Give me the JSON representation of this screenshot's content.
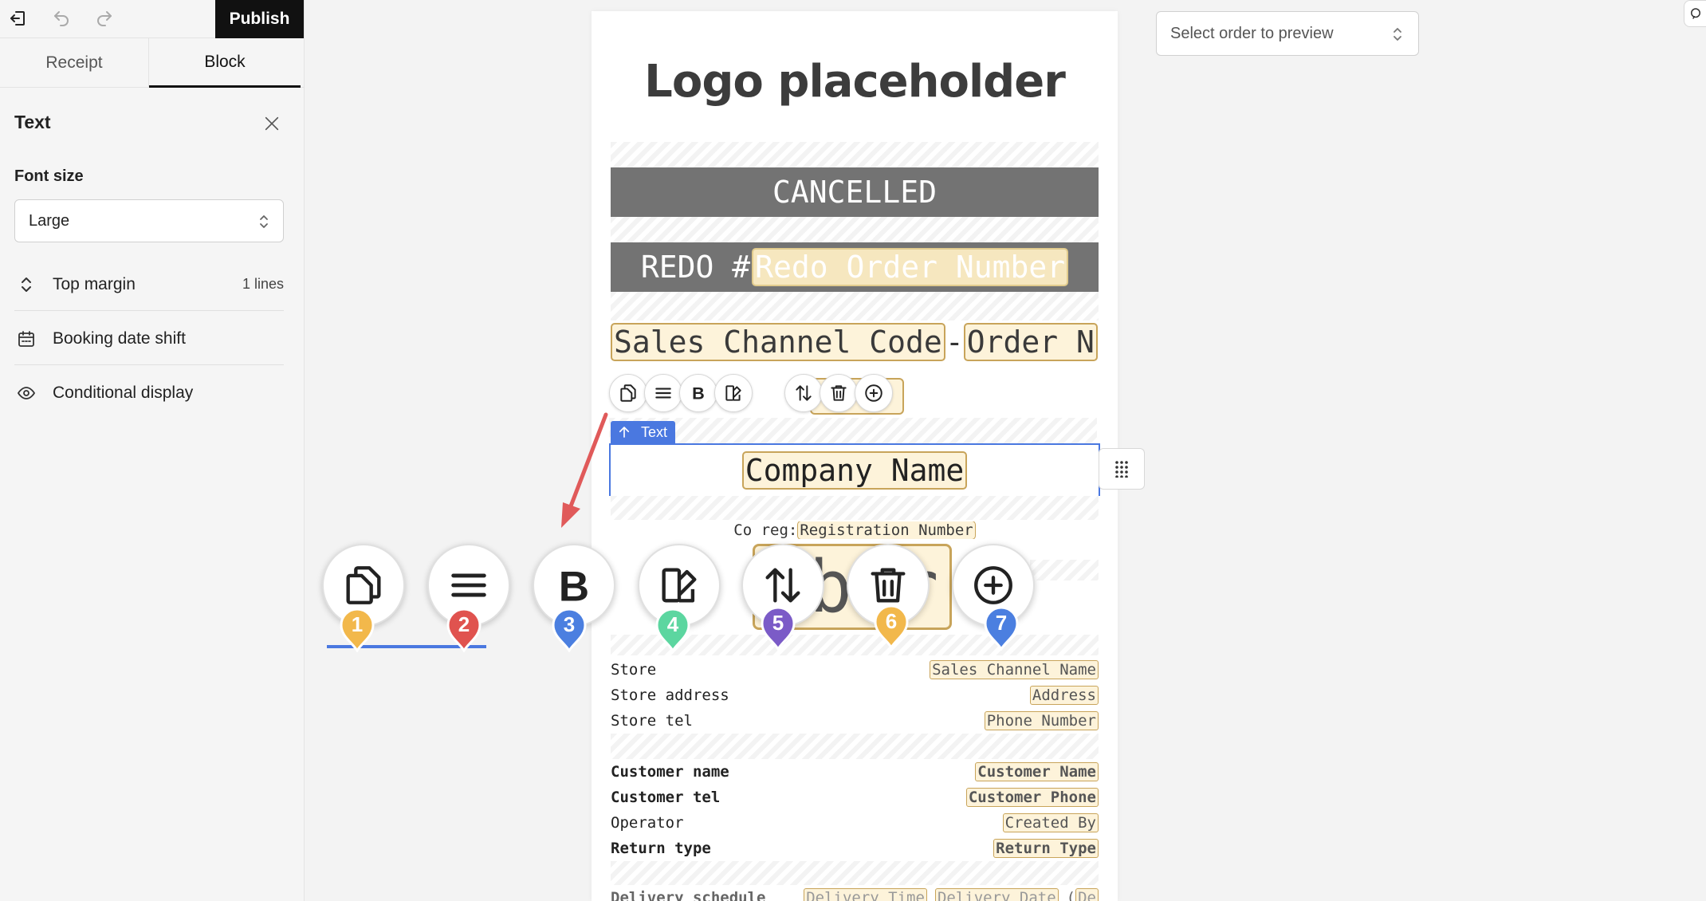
{
  "toolbar": {
    "publish_label": "Publish"
  },
  "tabs": [
    {
      "label": "Receipt"
    },
    {
      "label": "Block"
    }
  ],
  "panel": {
    "title": "Text",
    "font_size_label": "Font size",
    "font_size_value": "Large",
    "rows": [
      {
        "label": "Top margin",
        "value": "1 lines"
      },
      {
        "label": "Booking date shift"
      },
      {
        "label": "Conditional display"
      }
    ]
  },
  "preview": {
    "placeholder": "Select order to preview"
  },
  "receipt": {
    "logo": "Logo placeholder",
    "status": "CANCELLED",
    "redo_prefix": "REDO #",
    "redo_token": "Redo Order Number",
    "sales_code_token": "Sales Channel Code",
    "sales_dash": "-",
    "order_token": "Order N",
    "small_ghost": "mb r",
    "text_tag": "Text",
    "company_token": "Company Name",
    "coreg_label": "Co reg:",
    "coreg_token": "Registration Number",
    "store_rows": [
      {
        "key": "Store",
        "token": "Sales Channel Name"
      },
      {
        "key": "Store address",
        "token": "Address"
      },
      {
        "key": "Store tel",
        "token": "Phone Number"
      }
    ],
    "customer_rows": [
      {
        "key": "Customer name",
        "token": "Customer Name"
      },
      {
        "key": "Customer tel",
        "token": "Customer Phone"
      },
      {
        "key": "Operator",
        "token": "Created By"
      },
      {
        "key": "Return type",
        "token": "Return Type"
      }
    ],
    "delivery": {
      "key": "Delivery schedule",
      "time": "Delivery Time",
      "date": "Delivery Date",
      "open": "(",
      "partial": "De"
    }
  },
  "zoom": {
    "ghost": "mb r",
    "buttons": [
      {
        "name": "copy",
        "num": "1",
        "color": "#f2b84b"
      },
      {
        "name": "align",
        "num": "2",
        "color": "#e0534f"
      },
      {
        "name": "bold",
        "num": "3",
        "color": "#4b7fe0"
      },
      {
        "name": "style",
        "num": "4",
        "color": "#5cd6a0"
      },
      {
        "name": "swap",
        "num": "5",
        "color": "#7b5bc7"
      },
      {
        "name": "delete",
        "num": "6",
        "color": "#f2b84b"
      },
      {
        "name": "add",
        "num": "7",
        "color": "#4b7fe0"
      }
    ]
  },
  "colors": {
    "accent": "#4a78e0",
    "banner": "#737373",
    "token_border": "#c8a45a",
    "arrow": "#e05a5a"
  }
}
